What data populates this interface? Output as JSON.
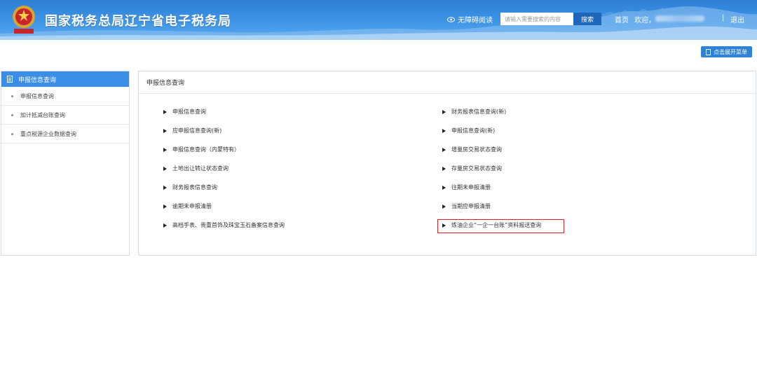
{
  "header": {
    "title": "国家税务总局辽宁省电子税务局",
    "accessible_label": "无障碍阅读",
    "search_placeholder": "请输入需要搜索的内容",
    "search_button": "搜索",
    "home": "首页",
    "welcome": "欢迎，",
    "separator": "|",
    "logout": "退出",
    "brand_color": "#2d7fd6"
  },
  "toolbar": {
    "expand_menu": "点击展开菜单"
  },
  "sidebar": {
    "title": "申报信息查询",
    "items": [
      {
        "label": "申报信息查询"
      },
      {
        "label": "加计抵减台账查询"
      },
      {
        "label": "重点税源企业数据查询"
      }
    ]
  },
  "panel": {
    "title": "申报信息查询",
    "left_links": [
      {
        "label": "申报信息查询"
      },
      {
        "label": "应申报信息查询(新)"
      },
      {
        "label": "申报信息查询（内蒙特有）"
      },
      {
        "label": "土地出让转让状态查询"
      },
      {
        "label": "财务报表信息查询"
      },
      {
        "label": "逾期未申报清册"
      },
      {
        "label": "高档手表、贵重首饰及珠宝玉石备案信息查询"
      }
    ],
    "right_links": [
      {
        "label": "财务报表信息查询(新)"
      },
      {
        "label": "申报信息查询(新)"
      },
      {
        "label": "增量房交易状态查询"
      },
      {
        "label": "存量房交易状态查询"
      },
      {
        "label": "往期未申报清册"
      },
      {
        "label": "当期应申报清册"
      },
      {
        "label": "炼油企业“一企一台账”资料报送查询"
      }
    ],
    "highlight_color": "#e02020"
  }
}
